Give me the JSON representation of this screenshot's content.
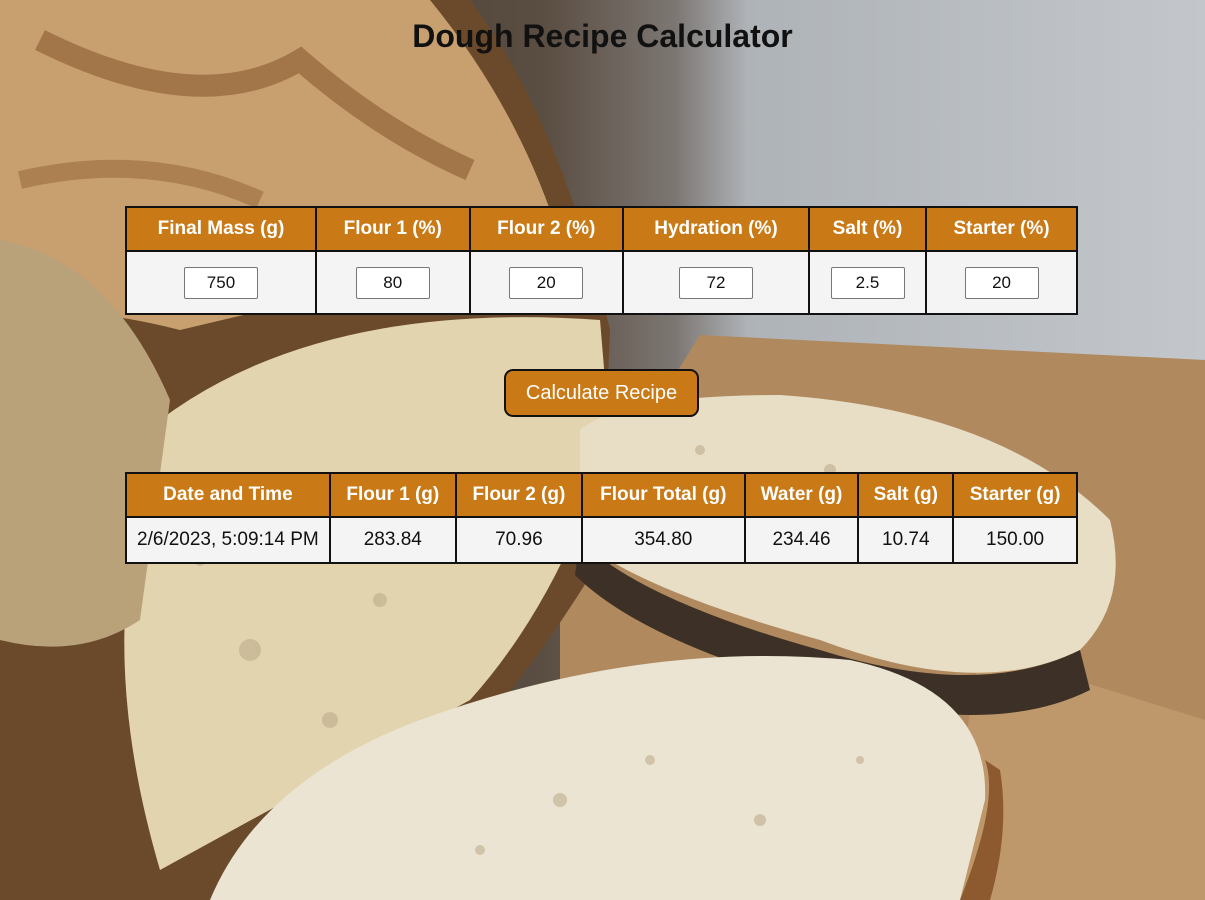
{
  "page": {
    "title": "Dough Recipe Calculator"
  },
  "inputs": {
    "headers": [
      "Final Mass (g)",
      "Flour 1 (%)",
      "Flour 2 (%)",
      "Hydration (%)",
      "Salt (%)",
      "Starter (%)"
    ],
    "values": [
      "750",
      "80",
      "20",
      "72",
      "2.5",
      "20"
    ]
  },
  "calculate_button": {
    "label": "Calculate Recipe"
  },
  "results": {
    "headers": [
      "Date and Time",
      "Flour 1 (g)",
      "Flour 2 (g)",
      "Flour Total (g)",
      "Water (g)",
      "Salt (g)",
      "Starter (g)"
    ],
    "rows": [
      [
        "2/6/2023, 5:09:14 PM",
        "283.84",
        "70.96",
        "354.80",
        "234.46",
        "10.74",
        "150.00"
      ]
    ]
  },
  "colors": {
    "accent": "#c97a16",
    "cell_background": "#f4f4f4",
    "border": "#111111"
  }
}
